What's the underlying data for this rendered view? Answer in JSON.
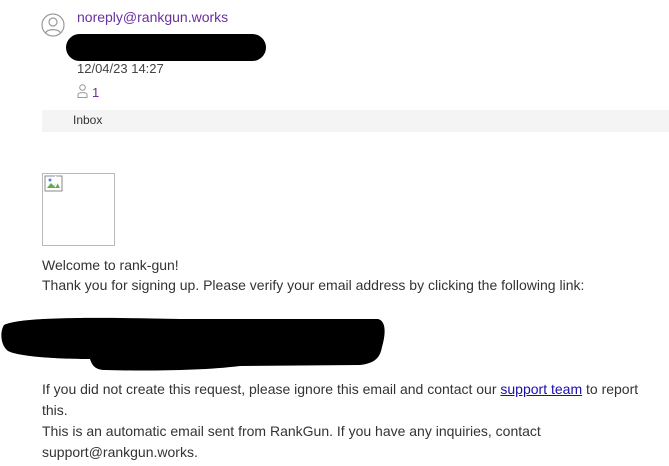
{
  "header": {
    "sender_email": "noreply@rankgun.works",
    "date": "12/04/23 14:27",
    "recipient_count": "1",
    "folder": "Inbox"
  },
  "body": {
    "welcome": "Welcome to rank-gun!",
    "verify": "Thank you for signing up. Please verify your email address by clicking the following link:",
    "ignore_prefix": "If you did not create this request, please ignore this email and contact our ",
    "support_link": "support team",
    "ignore_suffix": " to report this.",
    "auto_notice": "This is an automatic email sent from RankGun. If you have any inquiries, contact support@rankgun.works."
  },
  "icons": {
    "avatar": "person-circle-icon",
    "recipients": "person-icon",
    "image": "broken-image-icon"
  },
  "colors": {
    "accent": "#6b2fa0",
    "link": "#1a0dab",
    "redaction": "#000000"
  }
}
